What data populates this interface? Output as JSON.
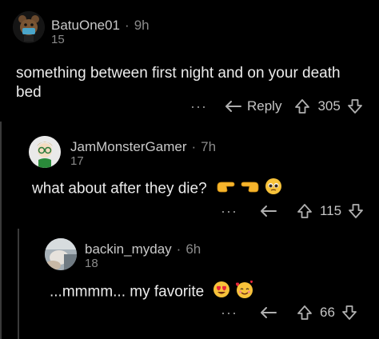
{
  "comments": [
    {
      "username": "BatuOne01",
      "separator": "·",
      "time": "9h",
      "level": "15",
      "text_line1": "something between first night and on your death",
      "text_line2": "bed",
      "more": "···",
      "reply_label": "Reply",
      "votes": "305"
    },
    {
      "username": "JamMonsterGamer",
      "separator": "·",
      "time": "7h",
      "level": "17",
      "text": "what about after they die?",
      "emojis": [
        "pointing-hand-emoji",
        "pointing-hand-emoji",
        "pleading-face-emoji"
      ],
      "more": "···",
      "votes": "115"
    },
    {
      "username": "backin_myday",
      "separator": "·",
      "time": "6h",
      "level": "18",
      "text": "...mmmm... my favorite",
      "emojis": [
        "heart-eyes-emoji",
        "smiling-face-with-hearts-emoji"
      ],
      "more": "···",
      "votes": "66"
    }
  ],
  "colors": {
    "background": "#000000",
    "thread_line": "#3a3a3a",
    "text": "#ececec",
    "muted": "#8a8a8a",
    "emoji_yellow": "#f7c23a"
  }
}
